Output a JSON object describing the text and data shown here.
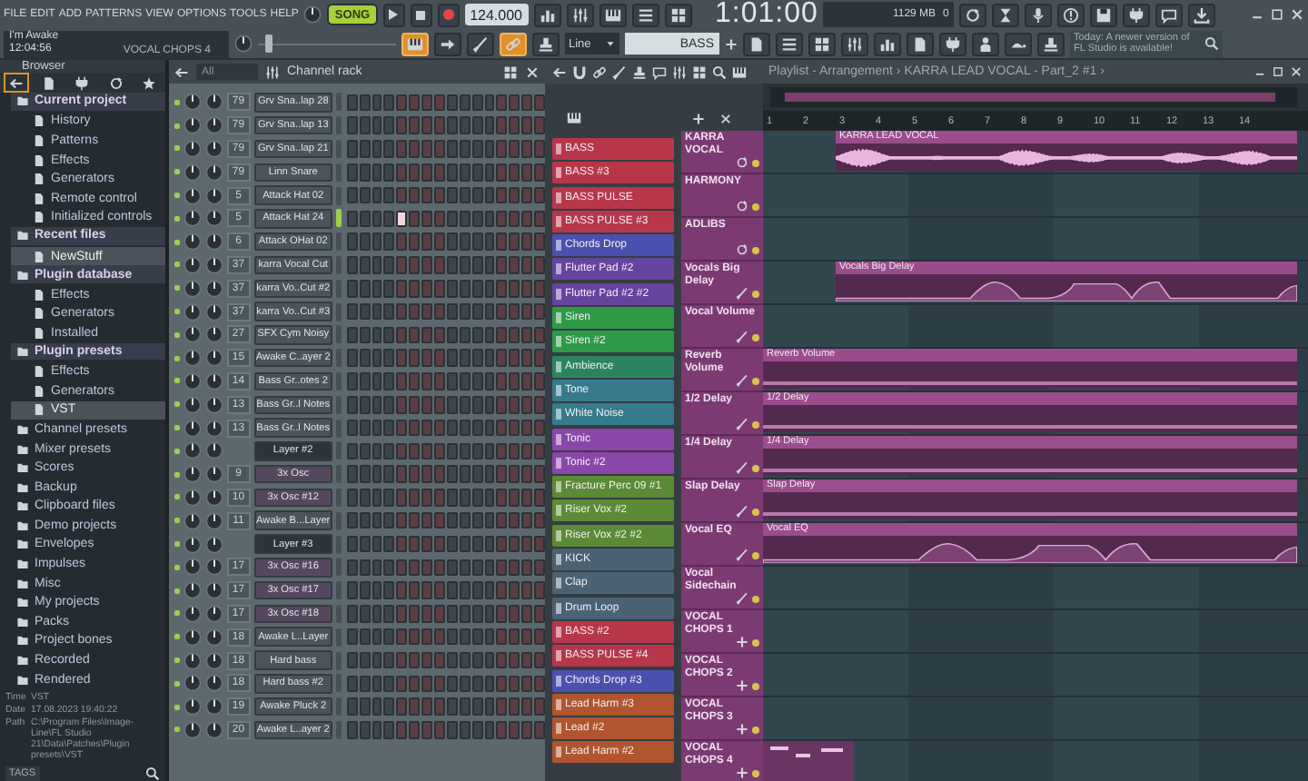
{
  "menu": [
    "FILE",
    "EDIT",
    "ADD",
    "PATTERNS",
    "VIEW",
    "OPTIONS",
    "TOOLS",
    "HELP"
  ],
  "transport": {
    "mode": "SONG",
    "song_mode": true,
    "tempo": "124.000",
    "time": "1:01:00",
    "memory": "1129 MB",
    "polyphony": "0"
  },
  "hint_bar": {
    "title": "I'm Awake",
    "time": "12:04:56",
    "pattern": "VOCAL CHOPS 4"
  },
  "pitch_slider": {
    "level": 0.05
  },
  "tools": [
    {
      "kind": "piano",
      "on": true
    },
    {
      "kind": "arrow",
      "on": false
    },
    {
      "kind": "brush",
      "on": false
    },
    {
      "kind": "chain",
      "on": true
    },
    {
      "kind": "stamp",
      "on": false
    }
  ],
  "snap": "Line",
  "pattern_selector": "BASS",
  "news": "Today: A newer version of FL Studio is available!",
  "browser": {
    "title": "Browser",
    "tabs": [
      {
        "kind": "back",
        "selected": true
      },
      {
        "kind": "file",
        "selected": false
      },
      {
        "kind": "plug",
        "selected": false
      },
      {
        "kind": "loop",
        "selected": false
      },
      {
        "kind": "star",
        "selected": false
      }
    ],
    "items": [
      {
        "label": "Current project",
        "expanded": true,
        "selected": false,
        "children": [
          {
            "label": "History",
            "selected": false
          },
          {
            "label": "Patterns",
            "selected": false
          },
          {
            "label": "Effects",
            "selected": false
          },
          {
            "label": "Generators",
            "selected": false
          },
          {
            "label": "Remote control",
            "selected": false
          },
          {
            "label": "Initialized controls",
            "selected": false
          }
        ]
      },
      {
        "label": "Recent files",
        "expanded": true,
        "selected": false,
        "children": [
          {
            "label": "NewStuff",
            "selected": true
          }
        ]
      },
      {
        "label": "Plugin database",
        "expanded": true,
        "selected": false,
        "children": [
          {
            "label": "Effects",
            "selected": false
          },
          {
            "label": "Generators",
            "selected": false
          },
          {
            "label": "Installed",
            "selected": false
          }
        ]
      },
      {
        "label": "Plugin presets",
        "expanded": true,
        "selected": false,
        "children": [
          {
            "label": "Effects",
            "selected": false
          },
          {
            "label": "Generators",
            "selected": false
          },
          {
            "label": "VST",
            "selected": true
          }
        ]
      },
      {
        "label": "Channel presets",
        "selected": false
      },
      {
        "label": "Mixer presets",
        "selected": false
      },
      {
        "label": "Scores",
        "selected": false
      },
      {
        "label": "Backup",
        "selected": false
      },
      {
        "label": "Clipboard files",
        "selected": false
      },
      {
        "label": "Demo projects",
        "selected": false
      },
      {
        "label": "Envelopes",
        "selected": false
      },
      {
        "label": "Impulses",
        "selected": false
      },
      {
        "label": "Misc",
        "selected": false
      },
      {
        "label": "My projects",
        "selected": false
      },
      {
        "label": "Packs",
        "selected": false
      },
      {
        "label": "Project bones",
        "selected": false
      },
      {
        "label": "Recorded",
        "selected": false
      },
      {
        "label": "Rendered",
        "selected": false
      }
    ],
    "info": [
      {
        "label": "Time",
        "value": "VST"
      },
      {
        "label": "Date",
        "value": "17.08.2023 19:40:22"
      },
      {
        "label": "Path",
        "value": "C:\\Program Files\\Image-Line\\FL Studio 21\\Data\\Patches\\Plugin presets\\VST"
      }
    ],
    "tags": "TAGS"
  },
  "channel_rack": {
    "filter": "All",
    "title": "Channel rack",
    "channels": [
      {
        "number": "79",
        "name": "Grv Sna..lap 28",
        "kind": "sample",
        "selected": false
      },
      {
        "number": "79",
        "name": "Grv Sna..lap 13",
        "kind": "sample",
        "selected": false
      },
      {
        "number": "79",
        "name": "Grv Sna..lap 21",
        "kind": "sample",
        "selected": false
      },
      {
        "number": "79",
        "name": "Linn Snare",
        "kind": "sample",
        "selected": false
      },
      {
        "number": "5",
        "name": "Attack Hat 02",
        "kind": "sample",
        "selected": false
      },
      {
        "number": "5",
        "name": "Attack Hat 24",
        "kind": "sample",
        "selected": true,
        "steps_on": [
          false,
          false,
          false,
          false,
          true,
          false,
          false,
          false,
          false,
          false,
          false,
          false,
          false,
          false,
          false,
          false
        ]
      },
      {
        "number": "6",
        "name": "Attack OHat 02",
        "kind": "sample",
        "selected": false
      },
      {
        "number": "37",
        "name": "karra Vocal Cut",
        "kind": "sample",
        "selected": false
      },
      {
        "number": "37",
        "name": "karra Vo..Cut #2",
        "kind": "sample",
        "selected": false
      },
      {
        "number": "37",
        "name": "karra Vo..Cut #3",
        "kind": "sample",
        "selected": false
      },
      {
        "number": "27",
        "name": "SFX Cym Noisy",
        "kind": "sample",
        "selected": false
      },
      {
        "number": "15",
        "name": "Awake C..ayer 2",
        "kind": "sample",
        "selected": false
      },
      {
        "number": "14",
        "name": "Bass Gr..otes 2",
        "kind": "sample",
        "selected": false
      },
      {
        "number": "13",
        "name": "Bass Gr..l Notes",
        "kind": "sample",
        "selected": false
      },
      {
        "number": "13",
        "name": "Bass Gr..l Notes",
        "kind": "sample",
        "selected": false
      },
      {
        "name": "Layer #2",
        "kind": "layer",
        "selected": false
      },
      {
        "number": "9",
        "name": "3x Osc",
        "kind": "synth",
        "selected": false
      },
      {
        "number": "10",
        "name": "3x Osc #12",
        "kind": "synth",
        "selected": false
      },
      {
        "number": "11",
        "name": "Awake B...Layer",
        "kind": "sample",
        "selected": false
      },
      {
        "name": "Layer #3",
        "kind": "layer",
        "selected": false
      },
      {
        "number": "17",
        "name": "3x Osc #16",
        "kind": "synth",
        "selected": false
      },
      {
        "number": "17",
        "name": "3x Osc #17",
        "kind": "synth",
        "selected": false
      },
      {
        "number": "17",
        "name": "3x Osc #18",
        "kind": "synth",
        "selected": false
      },
      {
        "number": "18",
        "name": "Awake L..Layer",
        "kind": "sample",
        "selected": false
      },
      {
        "number": "18",
        "name": "Hard bass",
        "kind": "sample",
        "selected": false
      },
      {
        "number": "18",
        "name": "Hard bass #2",
        "kind": "sample",
        "selected": false
      },
      {
        "number": "19",
        "name": "Awake Pluck 2",
        "kind": "sample",
        "selected": false
      },
      {
        "number": "20",
        "name": "Awake L..ayer 2",
        "kind": "sample",
        "selected": false
      }
    ]
  },
  "patterns": [
    {
      "name": "BASS",
      "color": "#b8364a"
    },
    {
      "name": "BASS #3",
      "color": "#b8364a"
    },
    {
      "name": "BASS PULSE",
      "color": "#b8364a"
    },
    {
      "name": "BASS PULSE #3",
      "color": "#b8364a"
    },
    {
      "name": "Chords  Drop",
      "color": "#4b4fae"
    },
    {
      "name": "Flutter Pad #2",
      "color": "#6544a0"
    },
    {
      "name": "Flutter Pad #2 #2",
      "color": "#6544a0"
    },
    {
      "name": "Siren",
      "color": "#2e9a48"
    },
    {
      "name": "Siren #2",
      "color": "#2e9a48"
    },
    {
      "name": "Ambience",
      "color": "#2b8460"
    },
    {
      "name": "Tone",
      "color": "#367a8c"
    },
    {
      "name": "White Noise",
      "color": "#367a8c"
    },
    {
      "name": "Tonic",
      "color": "#8a46a8"
    },
    {
      "name": "Tonic #2",
      "color": "#8a46a8"
    },
    {
      "name": "Fracture Perc 09 #1",
      "color": "#5c8a36"
    },
    {
      "name": "Riser Vox #2",
      "color": "#5c8a36"
    },
    {
      "name": "Riser Vox #2 #2",
      "color": "#5c8a36"
    },
    {
      "name": "KICK",
      "color": "#4b6274"
    },
    {
      "name": "Clap",
      "color": "#4b6274"
    },
    {
      "name": "Drum Loop",
      "color": "#4b6274"
    },
    {
      "name": "BASS #2",
      "color": "#b8364a"
    },
    {
      "name": "BASS PULSE #4",
      "color": "#b8364a"
    },
    {
      "name": "Chords  Drop #3",
      "color": "#4b4fae"
    },
    {
      "name": "Lead Harm #3",
      "color": "#b0552f"
    },
    {
      "name": "Lead #2",
      "color": "#b0552f"
    },
    {
      "name": "Lead Harm #2",
      "color": "#b0552f"
    }
  ],
  "playlist": {
    "title": "Playlist - Arrangement › KARRA LEAD VOCAL - Part_2 #1 ›",
    "bars": [
      "1",
      "2",
      "3",
      "4",
      "5",
      "6",
      "7",
      "8",
      "9",
      "10",
      "11",
      "12",
      "13",
      "14"
    ],
    "tracks": [
      {
        "name": "KARRA VOCAL",
        "kind": "audio",
        "clip": {
          "kind": "audio",
          "label": "KARRA LEAD VOCAL",
          "starts_at_song_start": false
        }
      },
      {
        "name": "HARMONY",
        "kind": "audio"
      },
      {
        "name": "ADLIBS",
        "kind": "audio"
      },
      {
        "name": "Vocals Big Delay",
        "kind": "automation",
        "clip": {
          "kind": "automation",
          "shaped": true,
          "label": "Vocals Big Delay",
          "starts_at_song_start": false
        }
      },
      {
        "name": "Vocal Volume",
        "kind": "automation"
      },
      {
        "name": "Reverb Volume",
        "kind": "automation",
        "clip": {
          "kind": "automation",
          "shaped": false,
          "label": "Reverb Volume",
          "starts_at_song_start": true
        }
      },
      {
        "name": "1/2 Delay",
        "kind": "automation",
        "clip": {
          "kind": "automation",
          "shaped": false,
          "label": "1/2 Delay",
          "starts_at_song_start": true
        }
      },
      {
        "name": "1/4 Delay",
        "kind": "automation",
        "clip": {
          "kind": "automation",
          "shaped": false,
          "label": "1/4 Delay",
          "starts_at_song_start": true
        }
      },
      {
        "name": "Slap Delay",
        "kind": "automation",
        "clip": {
          "kind": "automation",
          "shaped": false,
          "label": "Slap Delay",
          "starts_at_song_start": true
        }
      },
      {
        "name": "Vocal EQ",
        "kind": "automation",
        "clip": {
          "kind": "automation",
          "shaped": true,
          "label": "Vocal EQ",
          "starts_at_song_start": true
        }
      },
      {
        "name": "Vocal Sidechain",
        "kind": "automation"
      },
      {
        "name": "VOCAL CHOPS 1",
        "kind": "pattern"
      },
      {
        "name": "VOCAL CHOPS 2",
        "kind": "pattern"
      },
      {
        "name": "VOCAL CHOPS 3",
        "kind": "pattern"
      },
      {
        "name": "VOCAL CHOPS 4",
        "kind": "pattern",
        "clip": {
          "kind": "pattern",
          "starts_at_song_start": true
        }
      }
    ]
  }
}
